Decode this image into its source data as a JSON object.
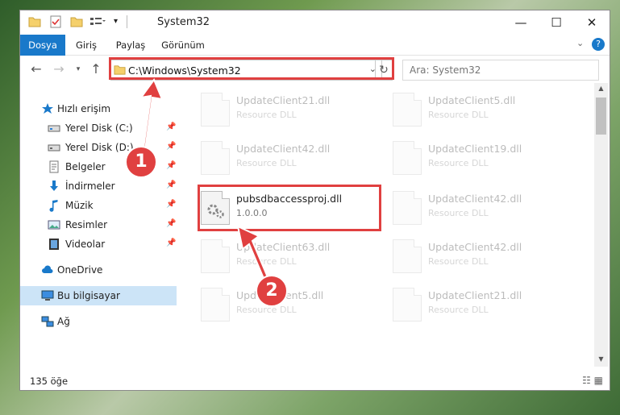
{
  "window": {
    "title": "System32",
    "controls": {
      "minimize": "—",
      "maximize": "☐",
      "close": "✕"
    }
  },
  "ribbon": {
    "tabs": [
      "Dosya",
      "Giriş",
      "Paylaş",
      "Görünüm"
    ],
    "active_tab": "Dosya"
  },
  "nav": {
    "address": "C:\\Windows\\System32",
    "search_placeholder": "Ara: System32"
  },
  "sidebar": {
    "quick_access": "Hızlı erişim",
    "items": [
      {
        "label": "Yerel Disk (C:)",
        "icon": "drive-icon"
      },
      {
        "label": "Yerel Disk (D:)",
        "icon": "drive-icon"
      },
      {
        "label": "Belgeler",
        "icon": "documents-icon"
      },
      {
        "label": "İndirmeler",
        "icon": "downloads-icon"
      },
      {
        "label": "Müzik",
        "icon": "music-icon"
      },
      {
        "label": "Resimler",
        "icon": "pictures-icon"
      },
      {
        "label": "Videolar",
        "icon": "videos-icon"
      }
    ],
    "onedrive": "OneDrive",
    "this_pc": "Bu bilgisayar",
    "network": "Ağ"
  },
  "files": [
    {
      "name": "UpdateClient21.dll",
      "sub": "Resource DLL",
      "faded": true
    },
    {
      "name": "UpdateClient5.dll",
      "sub": "Resource DLL",
      "faded": true
    },
    {
      "name": "UpdateClient42.dll",
      "sub": "Resource DLL",
      "faded": true
    },
    {
      "name": "UpdateClient19.dll",
      "sub": "Resource DLL",
      "faded": true
    },
    {
      "name": "pubsdbaccessproj.dll",
      "sub": "1.0.0.0",
      "faded": false
    },
    {
      "name": "UpdateClient42.dll",
      "sub": "Resource DLL",
      "faded": true
    },
    {
      "name": "UpdateClient63.dll",
      "sub": "Resource DLL",
      "faded": true
    },
    {
      "name": "UpdateClient42.dll",
      "sub": "Resource DLL",
      "faded": true
    },
    {
      "name": "UpdateClient5.dll",
      "sub": "Resource DLL",
      "faded": true
    },
    {
      "name": "UpdateClient21.dll",
      "sub": "Resource DLL",
      "faded": true
    }
  ],
  "status": {
    "count": "135 öğe"
  },
  "annotations": {
    "step1": "1",
    "step2": "2",
    "color": "#e04040"
  }
}
